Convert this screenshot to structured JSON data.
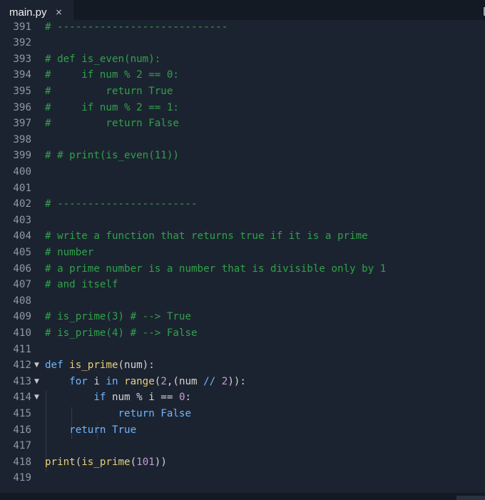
{
  "tab": {
    "filename": "main.py",
    "close_glyph": "×"
  },
  "editor": {
    "colors": {
      "background": "#1c2330",
      "comment": "#2fa24a",
      "keyword": "#6eb6ff",
      "function": "#e5d07a",
      "number": "#c39bd3"
    },
    "lines": [
      {
        "n": "391",
        "tokens": [
          {
            "t": "cm",
            "v": "# ----------------------------"
          }
        ]
      },
      {
        "n": "392",
        "tokens": []
      },
      {
        "n": "393",
        "tokens": [
          {
            "t": "cm",
            "v": "# def is_even(num):"
          }
        ]
      },
      {
        "n": "394",
        "tokens": [
          {
            "t": "cm",
            "v": "#     if num % 2 == 0:"
          }
        ]
      },
      {
        "n": "395",
        "tokens": [
          {
            "t": "cm",
            "v": "#         return True"
          }
        ]
      },
      {
        "n": "396",
        "tokens": [
          {
            "t": "cm",
            "v": "#     if num % 2 == 1:"
          }
        ]
      },
      {
        "n": "397",
        "tokens": [
          {
            "t": "cm",
            "v": "#         return False"
          }
        ]
      },
      {
        "n": "398",
        "tokens": []
      },
      {
        "n": "399",
        "tokens": [
          {
            "t": "cm",
            "v": "# # print(is_even(11))"
          }
        ]
      },
      {
        "n": "400",
        "tokens": []
      },
      {
        "n": "401",
        "tokens": []
      },
      {
        "n": "402",
        "tokens": [
          {
            "t": "cm",
            "v": "# -----------------------"
          }
        ]
      },
      {
        "n": "403",
        "tokens": []
      },
      {
        "n": "404",
        "tokens": [
          {
            "t": "cm",
            "v": "# write a function that returns true if it is a prime"
          }
        ]
      },
      {
        "n": "405",
        "tokens": [
          {
            "t": "cm",
            "v": "# number"
          }
        ]
      },
      {
        "n": "406",
        "tokens": [
          {
            "t": "cm",
            "v": "# a prime number is a number that is divisible only by 1"
          }
        ]
      },
      {
        "n": "407",
        "tokens": [
          {
            "t": "cm",
            "v": "# and itself"
          }
        ]
      },
      {
        "n": "408",
        "tokens": []
      },
      {
        "n": "409",
        "tokens": [
          {
            "t": "cm",
            "v": "# is_prime(3) # --> True"
          }
        ]
      },
      {
        "n": "410",
        "tokens": [
          {
            "t": "cm",
            "v": "# is_prime(4) # --> False"
          }
        ]
      },
      {
        "n": "411",
        "tokens": []
      },
      {
        "n": "412",
        "fold": "▼",
        "tokens": [
          {
            "t": "kw",
            "v": "def"
          },
          {
            "t": "op",
            "v": " "
          },
          {
            "t": "fn",
            "v": "is_prime"
          },
          {
            "t": "op",
            "v": "(num):"
          }
        ]
      },
      {
        "n": "413",
        "fold": "▼",
        "tokens": [
          {
            "t": "op",
            "v": "    "
          },
          {
            "t": "kw",
            "v": "for"
          },
          {
            "t": "op",
            "v": " i "
          },
          {
            "t": "kw",
            "v": "in"
          },
          {
            "t": "op",
            "v": " "
          },
          {
            "t": "fn",
            "v": "range"
          },
          {
            "t": "op",
            "v": "("
          },
          {
            "t": "num",
            "v": "2"
          },
          {
            "t": "op",
            "v": ",(num "
          },
          {
            "t": "kw",
            "v": "//"
          },
          {
            "t": "op",
            "v": " "
          },
          {
            "t": "num",
            "v": "2"
          },
          {
            "t": "op",
            "v": ")):"
          }
        ]
      },
      {
        "n": "414",
        "fold": "▼",
        "tokens": [
          {
            "t": "op",
            "v": "        "
          },
          {
            "t": "kw",
            "v": "if"
          },
          {
            "t": "op",
            "v": " num % i == "
          },
          {
            "t": "num",
            "v": "0"
          },
          {
            "t": "op",
            "v": ":"
          }
        ]
      },
      {
        "n": "415",
        "tokens": [
          {
            "t": "op",
            "v": "            "
          },
          {
            "t": "kw",
            "v": "return"
          },
          {
            "t": "op",
            "v": " "
          },
          {
            "t": "kw",
            "v": "False"
          }
        ]
      },
      {
        "n": "416",
        "tokens": [
          {
            "t": "op",
            "v": "    "
          },
          {
            "t": "kw",
            "v": "return"
          },
          {
            "t": "op",
            "v": " "
          },
          {
            "t": "kw",
            "v": "True"
          }
        ]
      },
      {
        "n": "417",
        "tokens": []
      },
      {
        "n": "418",
        "tokens": [
          {
            "t": "fn",
            "v": "print"
          },
          {
            "t": "op",
            "v": "("
          },
          {
            "t": "fn",
            "v": "is_prime"
          },
          {
            "t": "op",
            "v": "("
          },
          {
            "t": "num",
            "v": "101"
          },
          {
            "t": "op",
            "v": "))"
          }
        ]
      },
      {
        "n": "419",
        "tokens": []
      }
    ]
  }
}
